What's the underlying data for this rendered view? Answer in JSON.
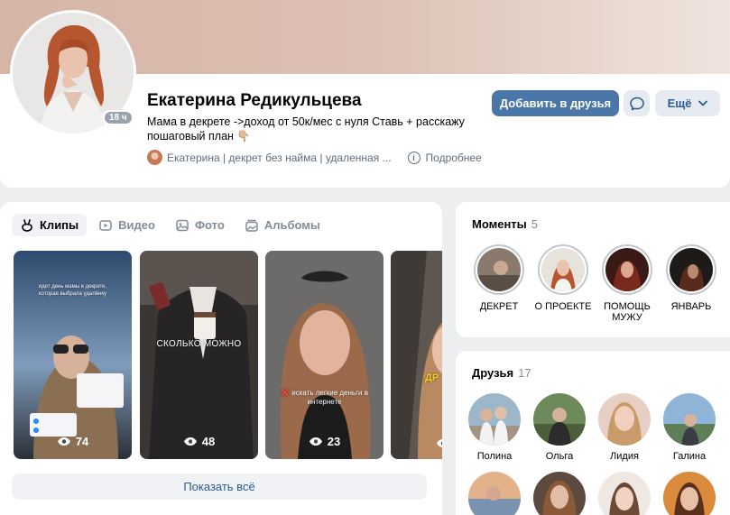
{
  "profile": {
    "name": "Екатерина Редикульцева",
    "online_badge": "18 ч",
    "status_line1": "Мама в декрете ->доход от 50к/мес с нуля Ставь + расскажу",
    "status_line2": "пошаговый план",
    "status_emoji": "👇🏼",
    "community_link": "Екатерина | декрет без найма | удаленная ...",
    "more_info": "Подробнее",
    "add_friend_button": "Добавить в друзья",
    "message_icon": "chat-bubble-icon",
    "more_button": "Ещё"
  },
  "media": {
    "tabs": [
      {
        "label": "Клипы",
        "icon": "clips-icon",
        "active": true
      },
      {
        "label": "Видео",
        "icon": "video-icon",
        "active": false
      },
      {
        "label": "Фото",
        "icon": "photo-icon",
        "active": false
      },
      {
        "label": "Альбомы",
        "icon": "albums-icon",
        "active": false
      }
    ],
    "clips": [
      {
        "views": "74",
        "overlay": "идет день мамы в декрете, которая выбрала удалёнку"
      },
      {
        "views": "48",
        "overlay": "СКОЛЬКО МОЖНО"
      },
      {
        "views": "23",
        "overlay": "❌ искать легкие деньги в интернете"
      },
      {
        "views": "",
        "overlay": "ДР"
      }
    ],
    "show_all": "Показать всё"
  },
  "moments": {
    "title": "Моменты",
    "count": "5",
    "items": [
      {
        "label": "ДЕКРЕТ"
      },
      {
        "label": "О ПРОЕКТЕ"
      },
      {
        "label": "ПОМОЩЬ МУЖУ"
      },
      {
        "label": "ЯНВАРЬ"
      }
    ]
  },
  "friends": {
    "title": "Друзья",
    "count": "17",
    "items": [
      {
        "name": "Полина"
      },
      {
        "name": "Ольга"
      },
      {
        "name": "Лидия"
      },
      {
        "name": "Галина"
      },
      {
        "name": ""
      },
      {
        "name": ""
      },
      {
        "name": ""
      },
      {
        "name": ""
      }
    ]
  },
  "colors": {
    "accent": "#4a76a8",
    "link": "#2c5d8f",
    "secondary_button": "#e5ebf1",
    "page_background": "#edeef0"
  }
}
